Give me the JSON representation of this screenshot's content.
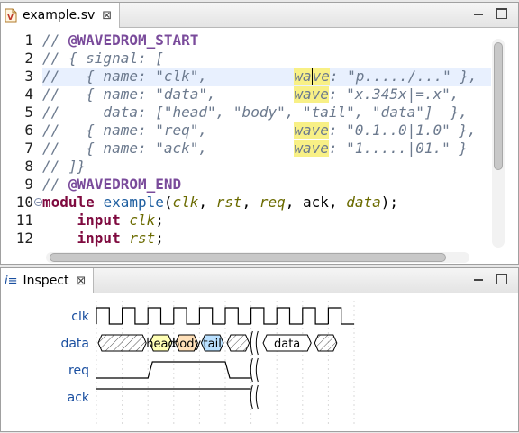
{
  "editor": {
    "tab_title": "example.sv",
    "tab_icon": "systemverilog-file-icon",
    "close_glyph": "⊠",
    "line_numbers": [
      "1",
      "2",
      "3",
      "4",
      "5",
      "6",
      "7",
      "8",
      "9",
      "10",
      "11",
      "12"
    ],
    "lines": [
      [
        {
          "t": "// ",
          "c": "cm"
        },
        {
          "t": "@WAVEDROM_START",
          "c": "an"
        }
      ],
      [
        {
          "t": "// { signal: [",
          "c": "cm"
        }
      ],
      [
        {
          "t": "//   { name: \"clk\",          ",
          "c": "cm"
        },
        {
          "t": "wa",
          "c": "cm occ"
        },
        {
          "t": "",
          "c": "caret"
        },
        {
          "t": "ve",
          "c": "cm occ"
        },
        {
          "t": ": \"p...../...\" },",
          "c": "cm"
        }
      ],
      [
        {
          "t": "//   { name: \"data\",         ",
          "c": "cm"
        },
        {
          "t": "wave",
          "c": "cm occ"
        },
        {
          "t": ": \"x.345x|=.x\",",
          "c": "cm"
        }
      ],
      [
        {
          "t": "//     data: [\"head\", \"body\", \"tail\", \"data\"]  },",
          "c": "cm"
        }
      ],
      [
        {
          "t": "//   { name: \"req\",          ",
          "c": "cm"
        },
        {
          "t": "wave",
          "c": "cm occ"
        },
        {
          "t": ": \"0.1..0|1.0\" },",
          "c": "cm"
        }
      ],
      [
        {
          "t": "//   { name: \"ack\",          ",
          "c": "cm"
        },
        {
          "t": "wave",
          "c": "cm occ"
        },
        {
          "t": ": \"1.....|01.\" }",
          "c": "cm"
        }
      ],
      [
        {
          "t": "// ]}",
          "c": "cm"
        }
      ],
      [
        {
          "t": "// ",
          "c": "cm"
        },
        {
          "t": "@WAVEDROM_END",
          "c": "an"
        }
      ],
      [
        {
          "t": "module ",
          "c": "kw"
        },
        {
          "t": "example",
          "c": "fn"
        },
        {
          "t": "(",
          "c": ""
        },
        {
          "t": "clk",
          "c": "pm"
        },
        {
          "t": ", ",
          "c": ""
        },
        {
          "t": "rst",
          "c": "pm"
        },
        {
          "t": ", ",
          "c": ""
        },
        {
          "t": "req",
          "c": "pm"
        },
        {
          "t": ", ack, ",
          "c": ""
        },
        {
          "t": "data",
          "c": "pm"
        },
        {
          "t": ");",
          "c": ""
        }
      ],
      [
        {
          "t": "    input ",
          "c": "kw"
        },
        {
          "t": "clk",
          "c": "pm"
        },
        {
          "t": ";",
          "c": ""
        }
      ],
      [
        {
          "t": "    input ",
          "c": "kw"
        },
        {
          "t": "rst",
          "c": "pm"
        },
        {
          "t": ";",
          "c": ""
        }
      ]
    ],
    "highlighted_line": 2,
    "folded_line": 9
  },
  "inspect": {
    "tab_title": "Inspect",
    "tab_icon": "inspect-icon",
    "icon_glyph": "i≡",
    "close_glyph": "⊠",
    "signals": [
      {
        "name": "clk",
        "wave": "p...../..."
      },
      {
        "name": "data",
        "wave": "x.345x|=.x",
        "data": [
          "head",
          "body",
          "tail",
          "data"
        ]
      },
      {
        "name": "req",
        "wave": "0.1..0|1.0"
      },
      {
        "name": "ack",
        "wave": "1.....|01."
      }
    ],
    "colors": {
      "head": "#ffffb4",
      "body": "#ffe0b9",
      "tail": "#b9e0ff",
      "data": "#ffffff",
      "line": "#000000",
      "label": "#1a4fa0"
    }
  }
}
